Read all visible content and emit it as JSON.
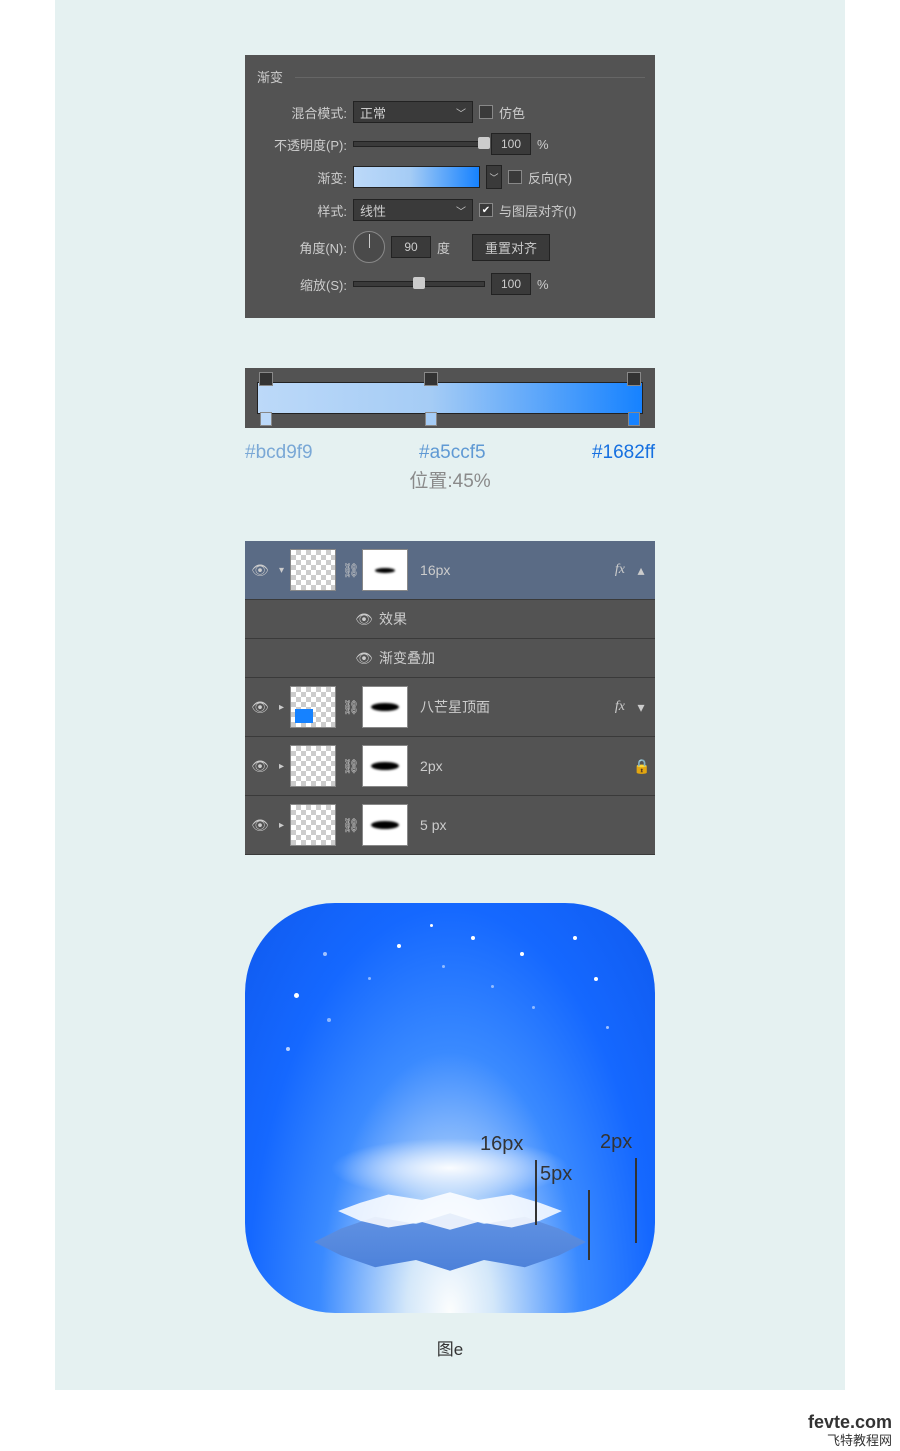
{
  "panel1": {
    "title": "渐变",
    "blend_label": "混合模式:",
    "blend_value": "正常",
    "dither_label": "仿色",
    "opacity_label": "不透明度(P):",
    "opacity_value": "100",
    "percent": "%",
    "gradient_label": "渐变:",
    "reverse_label": "反向(R)",
    "style_label": "样式:",
    "style_value": "线性",
    "align_label": "与图层对齐(I)",
    "angle_label": "角度(N):",
    "angle_value": "90",
    "degree": "度",
    "reset_btn": "重置对齐",
    "scale_label": "缩放(S):",
    "scale_value": "100"
  },
  "panel2": {
    "color1": "#bcd9f9",
    "color2": "#a5ccf5",
    "color3": "#1682ff",
    "pos_label": "位置:45%"
  },
  "layers": {
    "l1_name": "16px",
    "effects": "效果",
    "grad_overlay": "渐变叠加",
    "l2_name": "八芒星顶面",
    "l3_name": "2px",
    "l4_name": "5 px",
    "fx": "fx"
  },
  "result": {
    "anno1": "16px",
    "anno2": "5px",
    "anno3": "2px",
    "caption": "图e"
  },
  "watermark": {
    "line1": "fevte.com",
    "line2": "飞特教程网"
  }
}
